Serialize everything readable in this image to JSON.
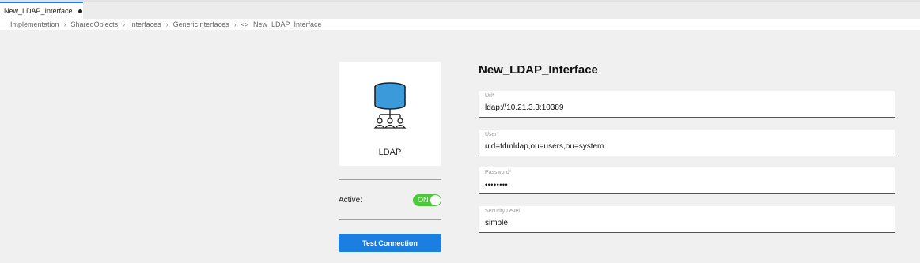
{
  "tab": {
    "label": "New_LDAP_Interface"
  },
  "breadcrumb": [
    "Implementation",
    "SharedObjects",
    "Interfaces",
    "GenericInterfaces"
  ],
  "breadcrumb_current": "New_LDAP_Interface",
  "card": {
    "label": "LDAP"
  },
  "active": {
    "label": "Active:",
    "toggle": "ON"
  },
  "test_button": "Test Connection",
  "form": {
    "title": "New_LDAP_Interface",
    "fields": [
      {
        "label": "Url*",
        "value": "ldap://10.21.3.3:10389"
      },
      {
        "label": "User*",
        "value": "uid=tdmldap,ou=users,ou=system"
      },
      {
        "label": "Password*",
        "value": "••••••••"
      },
      {
        "label": "Security Level",
        "value": "simple"
      }
    ]
  },
  "colors": {
    "accent": "#1a7fe0",
    "toggle_on": "#4cc93a",
    "icon": "#3b9ad9"
  }
}
